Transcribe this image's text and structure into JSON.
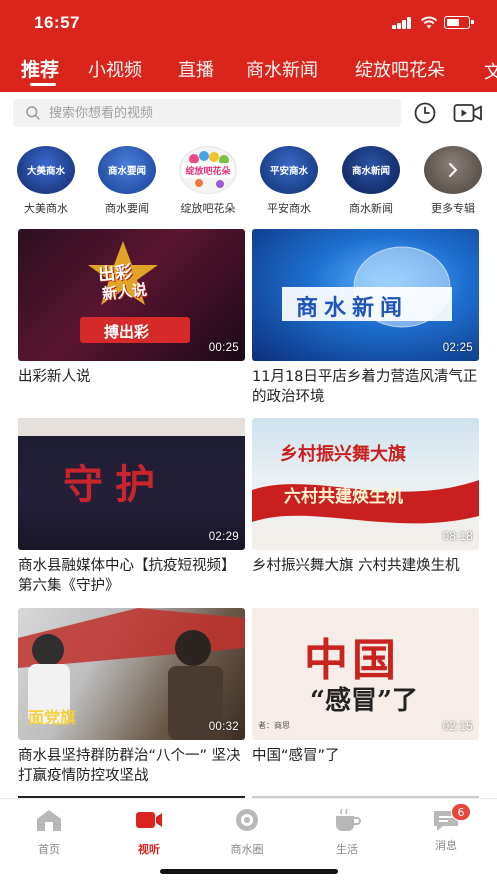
{
  "status_bar": {
    "time": "16:57"
  },
  "tabs": [
    {
      "label": "推荐",
      "active": true
    },
    {
      "label": "小视频",
      "active": false
    },
    {
      "label": "直播",
      "active": false
    },
    {
      "label": "商水新闻",
      "active": false
    },
    {
      "label": "绽放吧花朵",
      "active": false
    },
    {
      "label": "文",
      "active": false
    }
  ],
  "search": {
    "placeholder": "搜索你想看的视频"
  },
  "search_actions": {
    "history_icon": "clock-icon",
    "video_icon": "video-camera-icon"
  },
  "channels": [
    {
      "label": "大美商水",
      "badge_text": "大美商水",
      "color": "#1d3d8f"
    },
    {
      "label": "商水要闻",
      "badge_text": "商水要闻",
      "color": "#1d4aa0"
    },
    {
      "label": "绽放吧花朵",
      "badge_text": "绽放吧花朵",
      "color": "#f3f3f3"
    },
    {
      "label": "平安商水",
      "badge_text": "平安商水",
      "color": "#123c86"
    },
    {
      "label": "商水新闻",
      "badge_text": "商水新闻",
      "color": "#0f2f72"
    },
    {
      "label": "更多专辑",
      "badge_text": "",
      "color": "#6b625d"
    }
  ],
  "videos": [
    {
      "title": "出彩新人说",
      "duration": "00:25",
      "overlay_text_1": "出彩",
      "overlay_text_2": "新人说",
      "overlay_text_3": "搏出彩"
    },
    {
      "title": "11月18日平店乡着力营造风清气正的政治环境",
      "duration": "02:25",
      "overlay_text_1": "商水新闻"
    },
    {
      "title": "商水县融媒体中心【抗疫短视频】第六集《守护》",
      "duration": "02:29",
      "overlay_text_1": "守护"
    },
    {
      "title": "乡村振兴舞大旗  六村共建焕生机",
      "duration": "08:18",
      "overlay_text_1": "乡村振兴舞大旗",
      "overlay_text_2": "六村共建焕生机"
    },
    {
      "title": "商水县坚持群防群治“八个一” 坚决打赢疫情防控攻坚战",
      "duration": "00:32",
      "overlay_text_1": "面党旗"
    },
    {
      "title": "中国“感冒”了",
      "duration": "02:15",
      "overlay_text_1": "中国",
      "overlay_text_2": "“感冒”了",
      "overlay_text_3": "者：商思"
    }
  ],
  "bottom_nav": [
    {
      "label": "首页",
      "icon": "home-icon",
      "active": false
    },
    {
      "label": "视听",
      "icon": "video-icon",
      "active": true
    },
    {
      "label": "商水圈",
      "icon": "camera-lens-icon",
      "active": false
    },
    {
      "label": "生活",
      "icon": "coffee-cup-icon",
      "active": false
    },
    {
      "label": "消息",
      "icon": "message-icon",
      "active": false,
      "badge": "6"
    }
  ],
  "colors": {
    "brand_red": "#d9251c",
    "badge_red": "#e8453c"
  }
}
